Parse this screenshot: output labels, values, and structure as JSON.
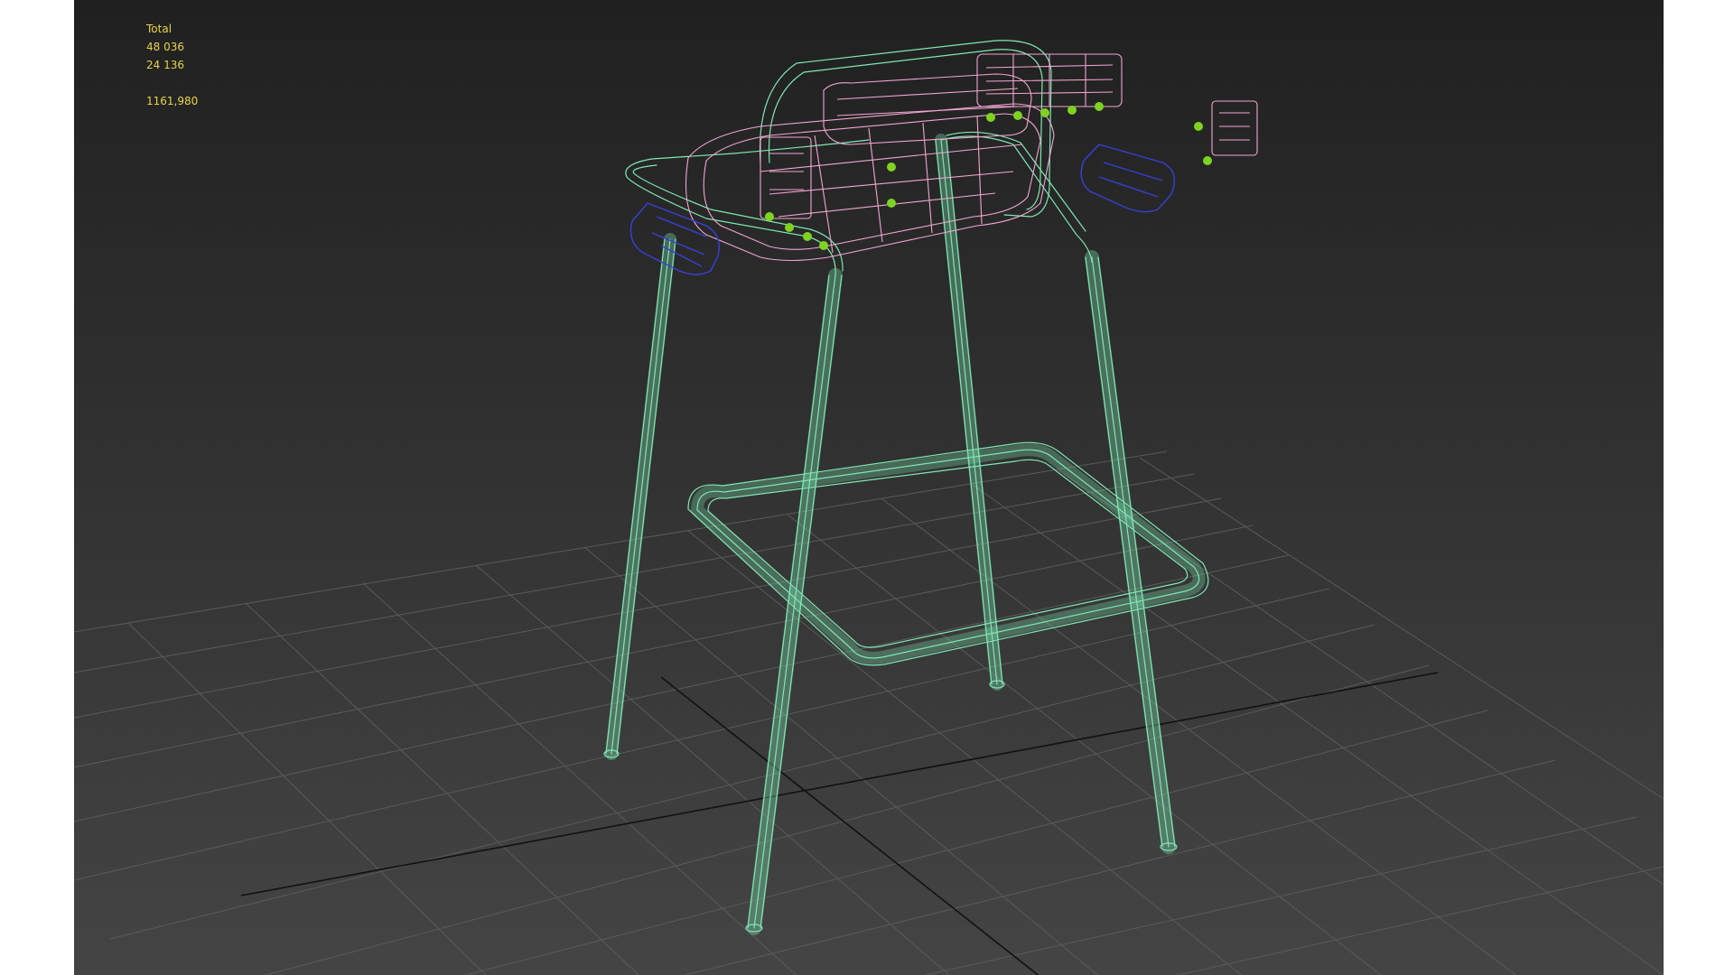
{
  "viewport": {
    "label": "",
    "background_top": "#202020",
    "background_bottom": "#454545",
    "grid_color": "#5a5a5a",
    "axis_color": "#111111"
  },
  "statistics": {
    "header": "Total",
    "polys": "48 036",
    "verts": "24 136",
    "fps": "1161,980",
    "text_color": "#e8d44a"
  },
  "model": {
    "frame_color": "#7fe8b4",
    "seat_color": "#f2a6d0",
    "hardware_color": "#3a3fd8",
    "vertex_color": "#7ed321"
  }
}
